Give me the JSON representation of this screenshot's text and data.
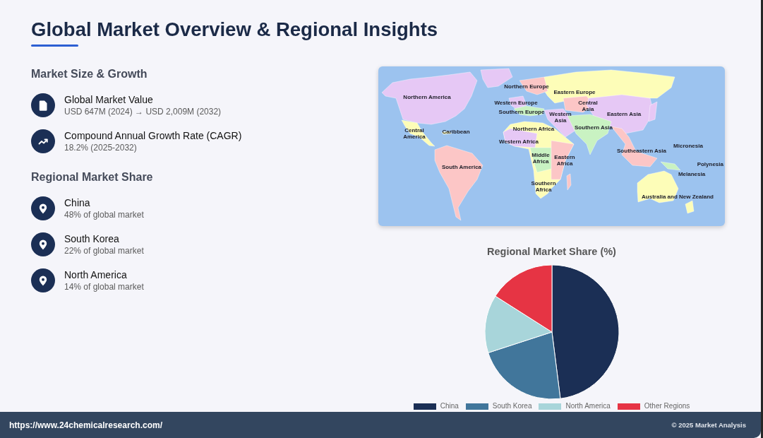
{
  "header": {
    "title": "Global Market Overview & Regional Insights"
  },
  "market_size": {
    "heading": "Market Size & Growth",
    "items": [
      {
        "kind": "document",
        "title": "Global Market Value",
        "detail": "USD 647M (2024) → USD 2,009M (2032)"
      },
      {
        "kind": "trend",
        "title": "Compound Annual Growth Rate (CAGR)",
        "detail": "18.2% (2025-2032)"
      }
    ]
  },
  "regional_share": {
    "heading": "Regional Market Share",
    "items": [
      {
        "kind": "location",
        "title": "China",
        "detail": "48% of global market"
      },
      {
        "kind": "location",
        "title": "South Korea",
        "detail": "22% of global market"
      },
      {
        "kind": "location",
        "title": "North America",
        "detail": "14% of global market"
      }
    ]
  },
  "map": {
    "regions": [
      {
        "label": "Northern America"
      },
      {
        "label": "Northern Europe"
      },
      {
        "label": "Eastern Europe"
      },
      {
        "label": "Western Europe"
      },
      {
        "label": "Central Asia"
      },
      {
        "label": "Southern Europe"
      },
      {
        "label": "Western Asia"
      },
      {
        "label": "Eastern Asia"
      },
      {
        "label": "Northern Africa"
      },
      {
        "label": "Southern Asia"
      },
      {
        "label": "Central America"
      },
      {
        "label": "Caribbean"
      },
      {
        "label": "Western Africa"
      },
      {
        "label": "Micronesia"
      },
      {
        "label": "Southeastern Asia"
      },
      {
        "label": "Middle Africa"
      },
      {
        "label": "Eastern Africa"
      },
      {
        "label": "South America"
      },
      {
        "label": "Polynesia"
      },
      {
        "label": "Melanesia"
      },
      {
        "label": "Southern Africa"
      },
      {
        "label": "Australia and New Zealand"
      }
    ]
  },
  "chart": {
    "chart_data": {
      "type": "pie",
      "title": "Regional Market Share (%)",
      "categories": [
        "China",
        "South Korea",
        "North America",
        "Other Regions"
      ],
      "values": [
        48,
        22,
        14,
        16
      ],
      "colors": [
        "#1b2f55",
        "#41769b",
        "#a8d5da",
        "#e63444"
      ],
      "legend": "bottom"
    }
  },
  "footer": {
    "url": "https://www.24chemicalresearch.com/",
    "copyright": "© 2025 Market Analysis"
  }
}
